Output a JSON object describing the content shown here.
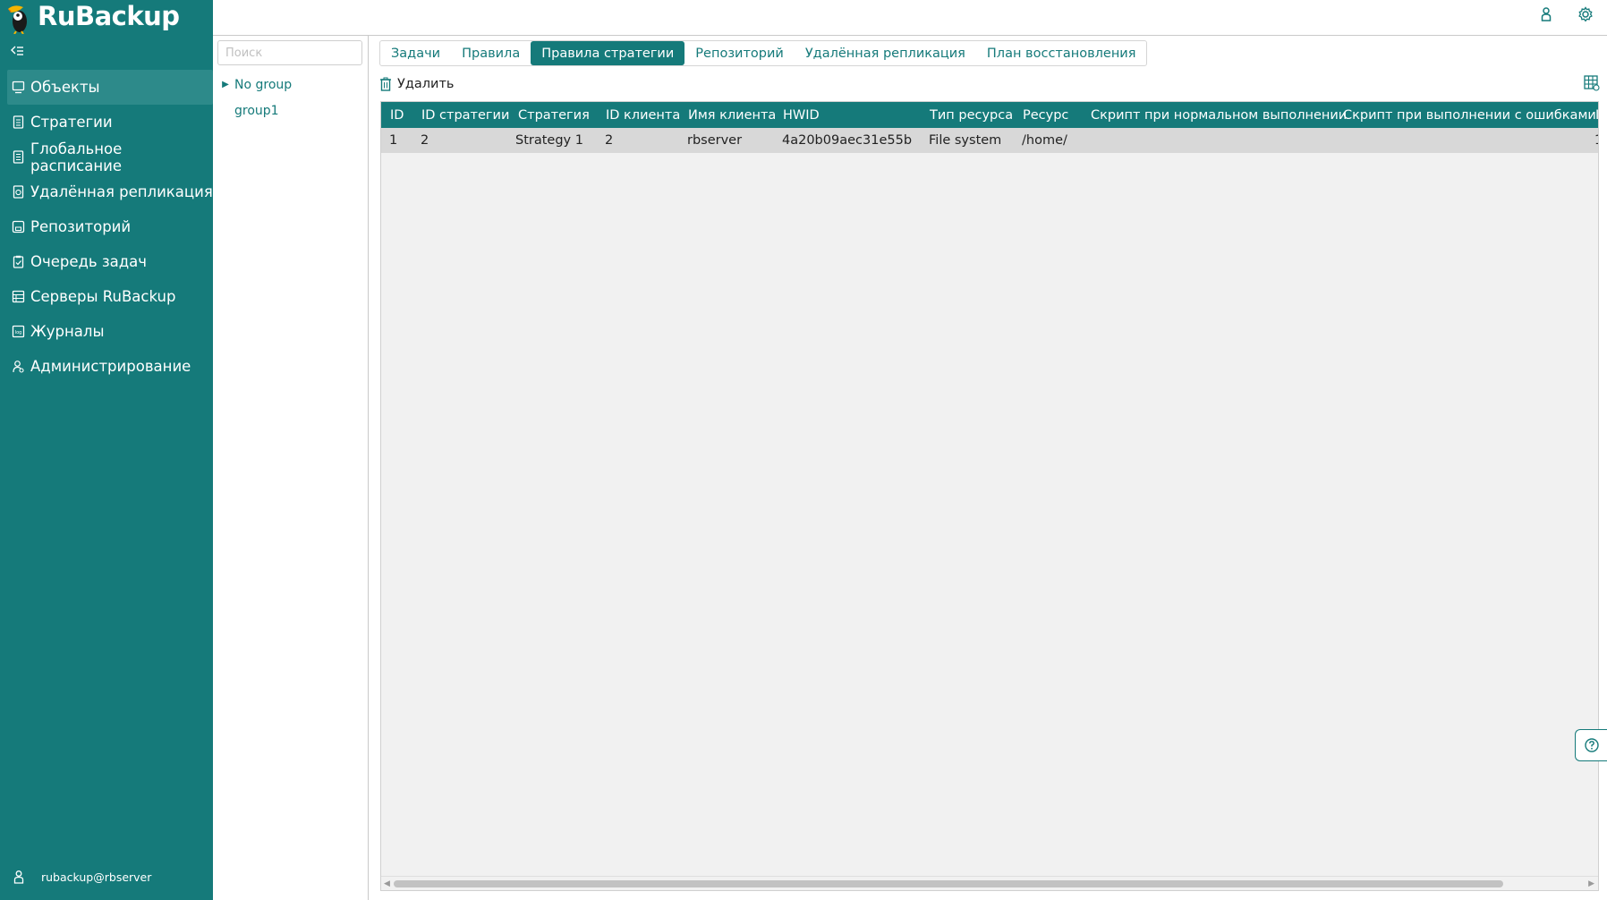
{
  "app": {
    "logo_text": "RuBackup",
    "accent_color": "#157a7a"
  },
  "sidebar": {
    "items": [
      {
        "label": "Объекты",
        "icon": "monitor-icon",
        "active": true
      },
      {
        "label": "Стратегии",
        "icon": "document-icon",
        "active": false
      },
      {
        "label": "Глобальное расписание",
        "icon": "schedule-icon",
        "active": false
      },
      {
        "label": "Удалённая репликация",
        "icon": "replication-icon",
        "active": false
      },
      {
        "label": "Репозиторий",
        "icon": "repository-icon",
        "active": false
      },
      {
        "label": "Очередь задач",
        "icon": "clipboard-icon",
        "active": false
      },
      {
        "label": "Серверы RuBackup",
        "icon": "server-icon",
        "active": false
      },
      {
        "label": "Журналы",
        "icon": "log-icon",
        "active": false
      },
      {
        "label": "Администрирование",
        "icon": "admin-icon",
        "active": false
      }
    ],
    "user": "rubackup@rbserver"
  },
  "groups": {
    "search_placeholder": "Поиск",
    "items": [
      {
        "label": "No group",
        "expandable": true
      },
      {
        "label": "group1",
        "expandable": false
      }
    ]
  },
  "tabs": [
    {
      "label": "Задачи",
      "active": false
    },
    {
      "label": "Правила",
      "active": false
    },
    {
      "label": "Правила стратегии",
      "active": true
    },
    {
      "label": "Репозиторий",
      "active": false
    },
    {
      "label": "Удалённая репликация",
      "active": false
    },
    {
      "label": "План восстановления",
      "active": false
    }
  ],
  "toolbar": {
    "delete_label": "Удалить"
  },
  "table": {
    "columns": [
      "ID",
      "ID стратегии",
      "Стратегия",
      "ID клиента",
      "Имя клиента",
      "HWID",
      "Тип ресурса",
      "Ресурс",
      "Скрипт при нормальном выполнении",
      "Скрипт при выполнении с ошибками",
      "I"
    ],
    "rows": [
      [
        "1",
        "2",
        "Strategy 1",
        "2",
        "rbserver",
        "4a20b09aec31e55b",
        "File system",
        "/home/",
        "",
        "",
        "1"
      ]
    ]
  }
}
